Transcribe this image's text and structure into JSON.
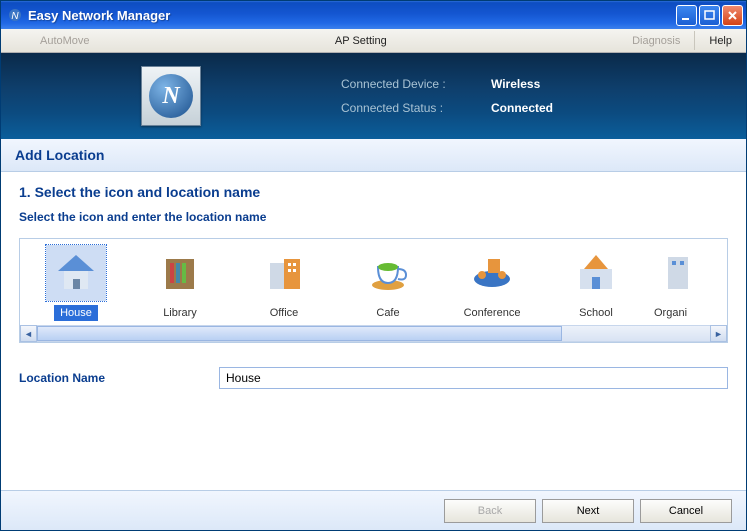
{
  "window": {
    "title": "Easy Network Manager"
  },
  "menu": {
    "automove": "AutoMove",
    "apsetting": "AP Setting",
    "diagnosis": "Diagnosis",
    "help": "Help"
  },
  "header": {
    "device_label": "Connected Device :",
    "device_value": "Wireless",
    "status_label": "Connected Status :",
    "status_value": "Connected"
  },
  "section": {
    "title": "Add Location"
  },
  "step": {
    "title": "1. Select the icon and location name",
    "subtitle": "Select the icon and enter the location name"
  },
  "locations": {
    "items": [
      {
        "label": "House",
        "icon": "house-icon"
      },
      {
        "label": "Library",
        "icon": "library-icon"
      },
      {
        "label": "Office",
        "icon": "office-icon"
      },
      {
        "label": "Cafe",
        "icon": "cafe-icon"
      },
      {
        "label": "Conference",
        "icon": "conference-icon"
      },
      {
        "label": "School",
        "icon": "school-icon"
      },
      {
        "label": "Organi",
        "icon": "organization-icon"
      }
    ],
    "selected_index": 0
  },
  "field": {
    "label": "Location Name",
    "value": "House"
  },
  "footer": {
    "back": "Back",
    "next": "Next",
    "cancel": "Cancel"
  }
}
